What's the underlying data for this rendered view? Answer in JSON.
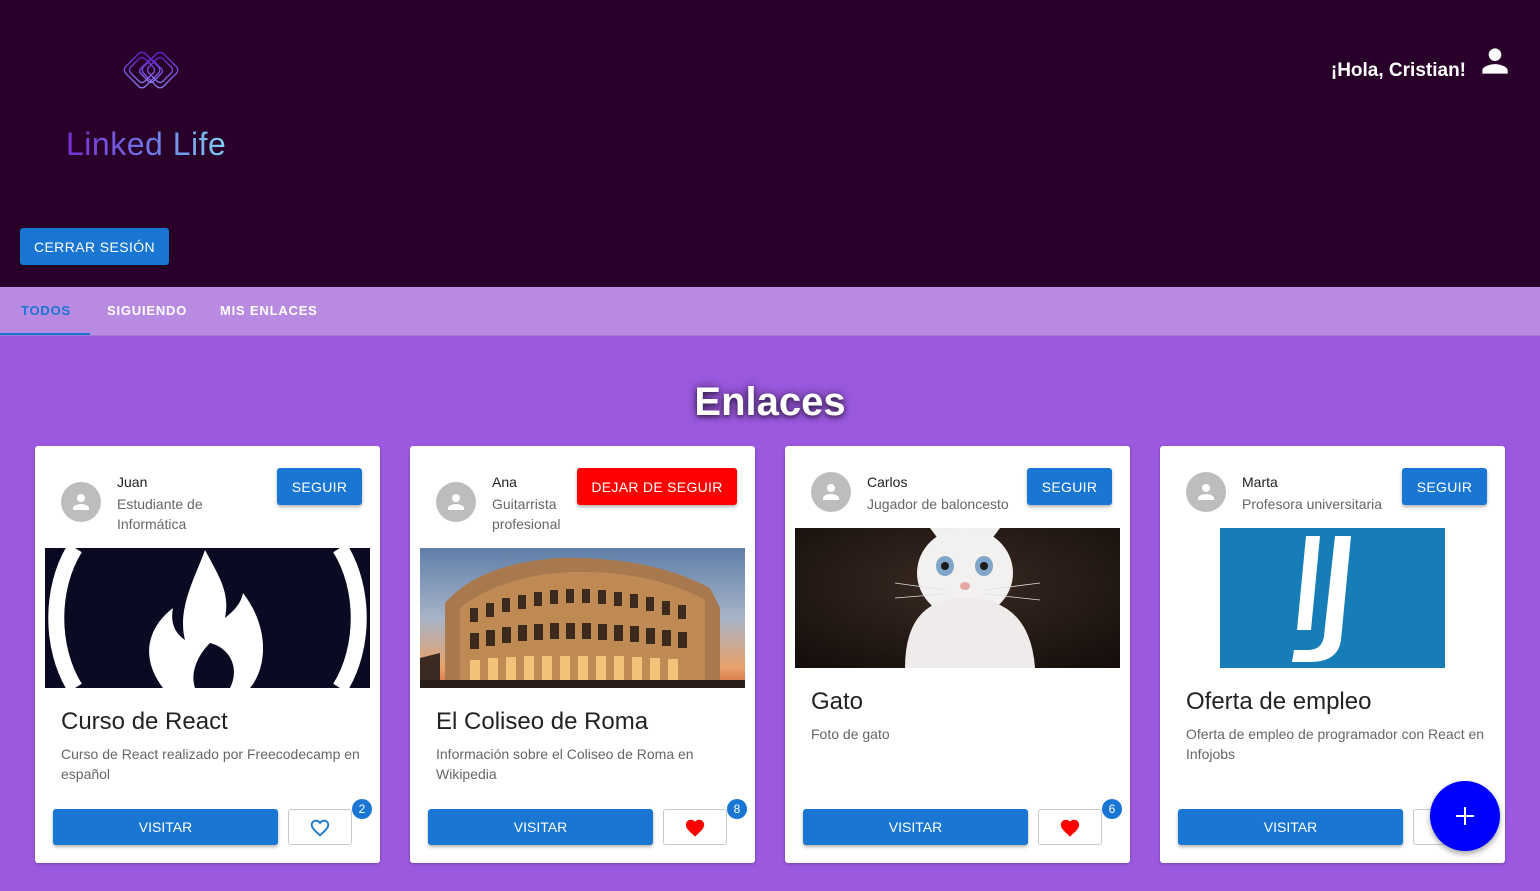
{
  "header": {
    "logo_text": "Linked Life",
    "greeting": "¡Hola, Cristian!",
    "logout_label": "CERRAR SESIÓN",
    "background": "#28002a"
  },
  "tabs": [
    {
      "label": "TODOS",
      "active": true
    },
    {
      "label": "SIGUIENDO",
      "active": false
    },
    {
      "label": "MIS ENLACES",
      "active": false
    }
  ],
  "section_title": "Enlaces",
  "colors": {
    "primary": "#1976d2",
    "unfollow": "#ff0000",
    "like": "#ff0000",
    "fab": "#0000ff",
    "page_bg": "#9c59e0"
  },
  "cards": [
    {
      "author": "Juan",
      "subtitle": "Estudiante de Informática",
      "follow_label": "SEGUIR",
      "title": "Curso de React",
      "description": "Curso de React realizado por Freecodecamp en español",
      "image": "freecodecamp-logo",
      "visit_label": "VISITAR",
      "likes": "2",
      "liked": false
    },
    {
      "author": "Ana",
      "subtitle": "Guitarrista profesional",
      "follow_label": "DEJAR DE SEGUIR",
      "title": "El Coliseo de Roma",
      "description": "Información sobre el Coliseo de Roma en Wikipedia",
      "image": "colosseum-photo",
      "visit_label": "VISITAR",
      "likes": "8",
      "liked": true
    },
    {
      "author": "Carlos",
      "subtitle": "Jugador de baloncesto",
      "follow_label": "SEGUIR",
      "title": "Gato",
      "description": "Foto de gato",
      "image": "kitten-photo",
      "visit_label": "VISITAR",
      "likes": "6",
      "liked": true
    },
    {
      "author": "Marta",
      "subtitle": "Profesora universitaria",
      "follow_label": "SEGUIR",
      "title": "Oferta de empleo",
      "description": "Oferta de empleo de programador con React en Infojobs",
      "image": "infojobs-logo",
      "visit_label": "VISITAR"
    }
  ],
  "fab_icon": "plus-icon"
}
